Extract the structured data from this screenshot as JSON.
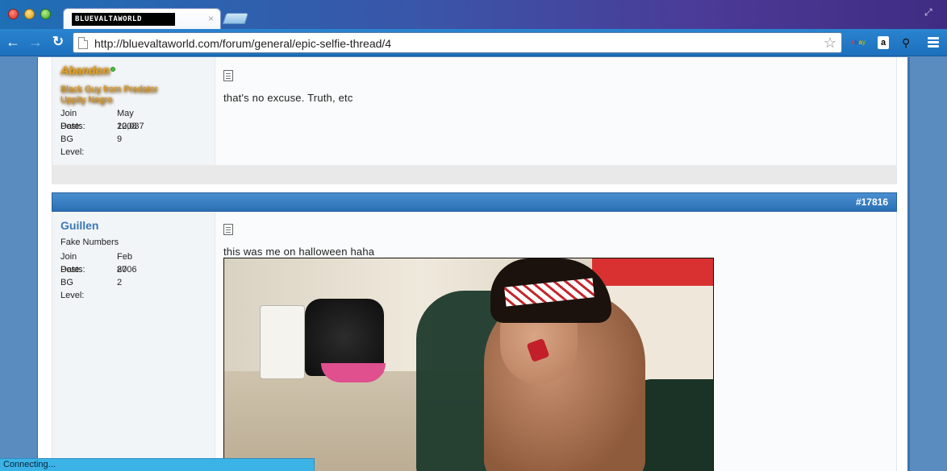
{
  "browser": {
    "tab_title": "BLUEVALTAWORLD",
    "tab_close": "×",
    "url": "http://bluevaltaworld.com/forum/general/epic-selfie-thread/4",
    "status": "Connecting..."
  },
  "extensions": {
    "ebay_letters": [
      "e",
      "b",
      "a",
      "y"
    ],
    "amazon_glyph": "a",
    "tool_glyph": "⚲"
  },
  "posts": [
    {
      "username": "Abandon",
      "online": true,
      "user_title_lines": [
        "Black Guy from Predator",
        "Uppity Negro"
      ],
      "stats": [
        {
          "label": "Join Date:",
          "value": "May 2008"
        },
        {
          "label": "Posts:",
          "value": "12,037"
        },
        {
          "label": "BG Level:",
          "value": "9"
        }
      ],
      "text": "that's no excuse. Truth, etc"
    },
    {
      "number": "#17816",
      "username": "Guillen",
      "user_title": "Fake Numbers",
      "stats": [
        {
          "label": "Join Date:",
          "value": "Feb 2006"
        },
        {
          "label": "Posts:",
          "value": "87"
        },
        {
          "label": "BG Level:",
          "value": "2"
        }
      ],
      "text": "this was me on halloween haha"
    }
  ]
}
